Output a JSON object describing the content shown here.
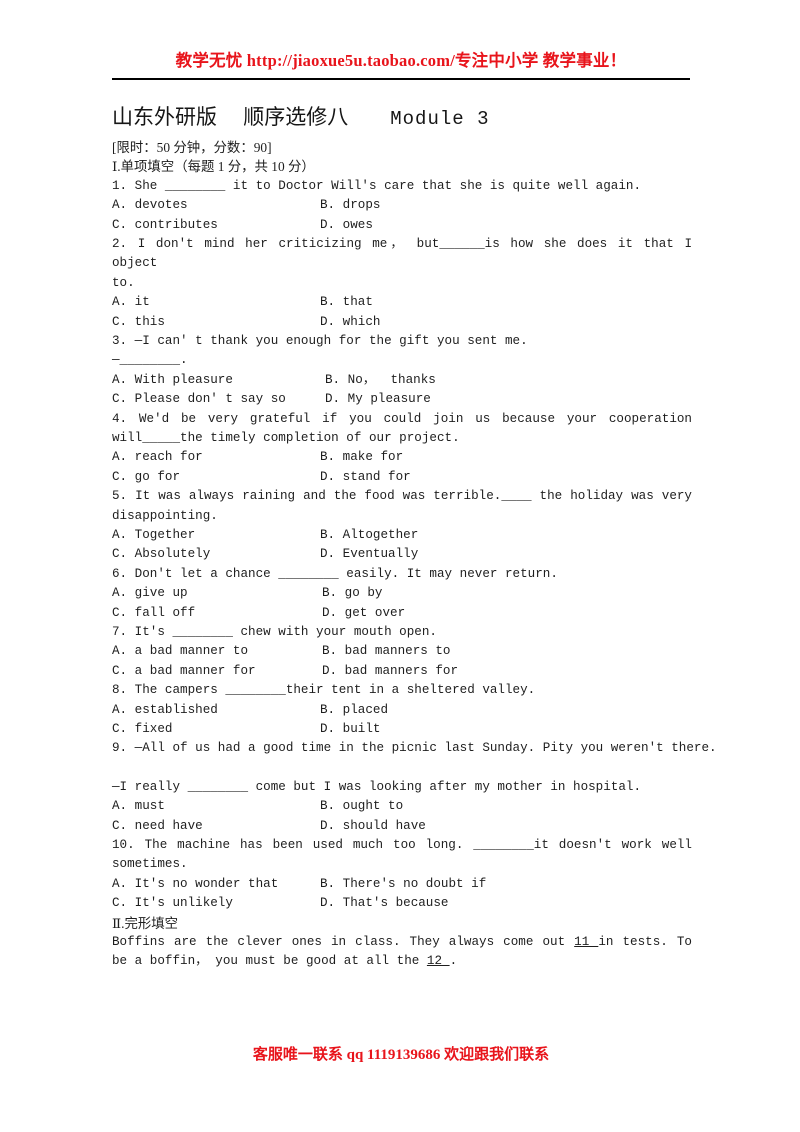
{
  "banner": {
    "text": "教学无忧 http://jiaoxue5u.taobao.com/专注中小学 教学事业！",
    "color": "#e8141b"
  },
  "title": {
    "prefix": "山东外研版　 顺序选修八　　",
    "module": "Module 3"
  },
  "meta": {
    "limit": "[限时：50 分钟，分数：90]",
    "section_one": "Ⅰ.单项填空（每题 1 分，共 10 分）"
  },
  "questions": [
    {
      "number": "1.",
      "stem": "1. She ________ it to Doctor Will's care that she is quite well again.",
      "options": [
        {
          "a": "A. devotes",
          "b": "B. drops"
        },
        {
          "a": "C. contributes",
          "b": "D. owes"
        }
      ]
    },
    {
      "number": "2.",
      "stem_line1": "2. I don't mind her criticizing me，  but______is how she does it that I object",
      "stem_line2": "to.",
      "options": [
        {
          "a": "A. it",
          "b": "B. that"
        },
        {
          "a": "C. this",
          "b": "D. which"
        }
      ]
    },
    {
      "number": "3.",
      "stem_line1": "3. —I can' t thank you enough for the gift you sent me.",
      "stem_line2": "—________.",
      "options": [
        {
          "a": "A. With pleasure",
          "b": "B. No，  thanks"
        },
        {
          "a": "C. Please don' t say so",
          "b": "D. My pleasure"
        }
      ]
    },
    {
      "number": "4.",
      "stem_line1": "4. We'd be very grateful if you could join us because your cooperation",
      "stem_line2": "will_____the timely completion of our project.",
      "options": [
        {
          "a": "A. reach for",
          "b": "B. make for"
        },
        {
          "a": "C. go for",
          "b": "D. stand for"
        }
      ]
    },
    {
      "number": "5.",
      "stem_line1": "5. It was always raining and the food was terrible.____ the holiday was very",
      "stem_line2": "disappointing.",
      "options": [
        {
          "a": "A. Together",
          "b": "B. Altogether"
        },
        {
          "a": "C. Absolutely",
          "b": "D. Eventually"
        }
      ]
    },
    {
      "number": "6.",
      "stem": "6. Don't let a chance ________ easily. It may never return.",
      "options": [
        {
          "a": "A. give up",
          "b": "B. go by"
        },
        {
          "a": "C. fall off",
          "b": "D. get over"
        }
      ]
    },
    {
      "number": "7.",
      "stem": "7. It's ________ chew with your mouth open.",
      "options": [
        {
          "a": "A. a bad manner to",
          "b": "B. bad manners to"
        },
        {
          "a": "C. a bad manner for",
          "b": "D. bad manners for"
        }
      ]
    },
    {
      "number": "8.",
      "stem": "8. The campers ________their tent in a sheltered valley.",
      "options": [
        {
          "a": "A. established",
          "b": "B. placed"
        },
        {
          "a": "C. fixed",
          "b": "D. built"
        }
      ]
    },
    {
      "number": "9.",
      "stem_line1": "9. —All of us had a good time in the picnic last Sunday. Pity you weren't there.",
      "stem_line2": "—I really ________ come but I was looking after my mother in hospital.",
      "options": [
        {
          "a": "A. must",
          "b": "B. ought to"
        },
        {
          "a": "C. need have",
          "b": "D. should have"
        }
      ]
    },
    {
      "number": "10.",
      "stem_line1": "10. The machine has been used much too long. ________it doesn't work well",
      "stem_line2": "sometimes.",
      "options": [
        {
          "a": "A. It's no wonder that",
          "b": "B. There's no doubt if"
        },
        {
          "a": "C. It's unlikely",
          "b": "D. That's because"
        }
      ]
    }
  ],
  "section_two": {
    "heading": "Ⅱ.完形填空",
    "passage_line1_a": "Boffins are the clever ones in class. They always come out ",
    "passage_line1_blank": " 11 ",
    "passage_line1_b": " in tests. To",
    "passage_line2_a": "be a boffin，  you must be good at all the ",
    "passage_line2_blank": " 12 ",
    "passage_line2_b": "."
  },
  "footer": {
    "text": "客服唯一联系 qq  1119139686 欢迎跟我们联系",
    "color": "#e8141b"
  }
}
